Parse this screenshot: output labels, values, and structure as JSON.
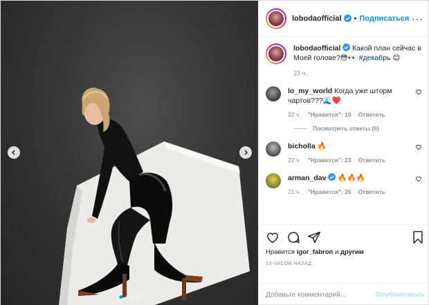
{
  "colors": {
    "accent": "#0095f6",
    "heart_red": "#ed4956",
    "muted": "#8e8e8e"
  },
  "media": {
    "carousel_dots": 4,
    "active_dot": 1,
    "prev_icon": "chevron-left-icon",
    "next_icon": "chevron-right-icon"
  },
  "header": {
    "username": "lobodaofficial",
    "verified": true,
    "separator": "•",
    "follow_label": "Подписаться",
    "more_label": "···"
  },
  "caption": {
    "username": "lobodaofficial",
    "text": "Какой план сейчас в Моей голове?😳👀",
    "hashtag": "#декабрь",
    "hashtag_emoji": "😊",
    "time": "23 ч."
  },
  "comments": [
    {
      "username": "lo_my_world",
      "verified": false,
      "text": "Когда уже шторм чартов???🌊❤️",
      "time": "22 ч.",
      "likes": "\"Нравится\": 19",
      "reply": "Ответить"
    },
    {
      "username": "bicholla",
      "verified": false,
      "text": "🔥",
      "time": "22 ч.",
      "likes": "\"Нравится\": 23",
      "reply": "Ответить"
    },
    {
      "username": "arman_dav",
      "verified": true,
      "text": "🔥🔥🔥",
      "time": "21 ч.",
      "likes": "\"Нравится\": 26",
      "reply": "Ответить"
    }
  ],
  "view_replies": "Посмотреть ответы (6)",
  "actions": {
    "like_icon": "heart-icon",
    "comment_icon": "comment-icon",
    "share_icon": "share-icon",
    "save_icon": "bookmark-icon"
  },
  "likes": {
    "prefix": "Нравится",
    "user": "igor_fabron",
    "middle": "и",
    "others": "другим"
  },
  "posted_ago": "23 ЧАСОВ НАЗАД",
  "add_comment": {
    "placeholder": "Добавьте комментарий...",
    "publish_label": "Опубликовать"
  }
}
